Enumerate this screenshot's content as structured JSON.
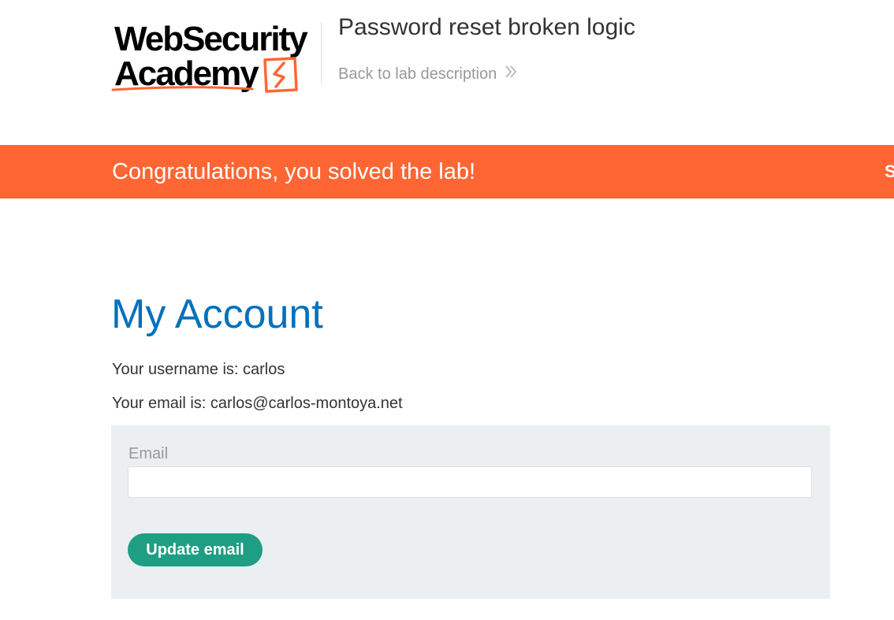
{
  "header": {
    "logo": {
      "line1": "WebSecurity",
      "line2": "Academy",
      "icon": "lightning-bolt-icon"
    },
    "lab_title": "Password reset broken logic",
    "back_link_label": "Back to lab description",
    "back_link_icon": "double-chevron-right-icon"
  },
  "banner": {
    "message": "Congratulations, you solved the lab!",
    "cut_off_text": "S",
    "background_color": "#ff6633"
  },
  "main": {
    "title": "My Account",
    "username_line": "Your username is: carlos",
    "email_line": "Your email is: carlos@carlos-montoya.net",
    "form": {
      "email_label": "Email",
      "email_value": "",
      "update_button_label": "Update email"
    }
  },
  "colors": {
    "title_blue": "#0071bc",
    "button_green": "#1e9e82",
    "logo_orange": "#ff6633",
    "panel_gray": "#ebeff2"
  }
}
